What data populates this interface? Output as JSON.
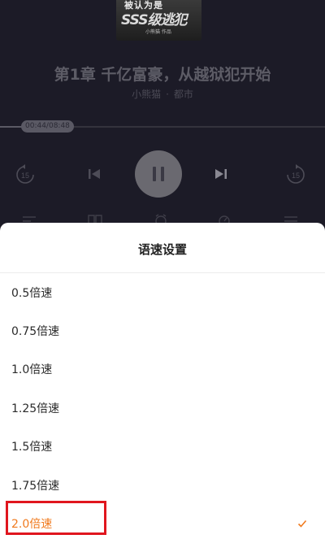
{
  "player": {
    "cover": {
      "line1": "被认为是",
      "line2": "SSS级逃犯",
      "line3": "小熊猫 作品"
    },
    "chapter_title": "第1章 千亿富豪，从越狱犯开始",
    "author": "小熊猫",
    "separator": "·",
    "genre": "都市",
    "time": "00:44/08:48",
    "progress": 0.085,
    "skip_back_label": "15",
    "skip_forward_label": "15"
  },
  "speed_sheet": {
    "title": "语速设置",
    "options": [
      {
        "label": "0.5倍速"
      },
      {
        "label": "0.75倍速"
      },
      {
        "label": "1.0倍速"
      },
      {
        "label": "1.25倍速"
      },
      {
        "label": "1.5倍速"
      },
      {
        "label": "1.75倍速"
      },
      {
        "label": "2.0倍速"
      }
    ],
    "selected_index": 6
  },
  "colors": {
    "accent": "#f07a1e",
    "annotation": "#e0161e"
  }
}
